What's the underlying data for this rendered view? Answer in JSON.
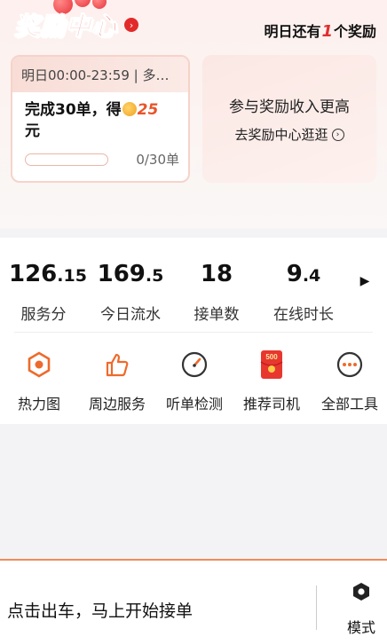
{
  "rewards": {
    "title": "奖励中心",
    "tomorrow_prefix": "明日还有",
    "tomorrow_count": "1",
    "tomorrow_suffix": "个奖励",
    "task": {
      "time": "明日00:00-23:59 | 多…",
      "desc_prefix": "完成30单，得",
      "coin_amount": "25",
      "desc_suffix": "元",
      "progress_text": "0/30单",
      "progress_fraction": 0
    },
    "more": {
      "title": "参与奖励收入更高",
      "link": "去奖励中心逛逛"
    }
  },
  "stats": [
    {
      "int": "126",
      "dec": ".15",
      "label": "服务分"
    },
    {
      "int": "169",
      "dec": ".5",
      "label": "今日流水"
    },
    {
      "int": "18",
      "dec": "",
      "label": "接单数"
    },
    {
      "int": "9",
      "dec": ".4",
      "label": "在线时长"
    }
  ],
  "tools": [
    {
      "label": "热力图",
      "icon": "heatmap-icon"
    },
    {
      "label": "周边服务",
      "icon": "thumbs-up-icon"
    },
    {
      "label": "听单检测",
      "icon": "gauge-icon"
    },
    {
      "label": "推荐司机",
      "icon": "red-envelope-icon",
      "badge": "500"
    },
    {
      "label": "全部工具",
      "icon": "more-icon"
    }
  ],
  "bottom": {
    "go_text": "点击出车，马上开始接单",
    "mode_label": "模式"
  },
  "colors": {
    "accent": "#e22a2a",
    "orange": "#f08a5a"
  }
}
